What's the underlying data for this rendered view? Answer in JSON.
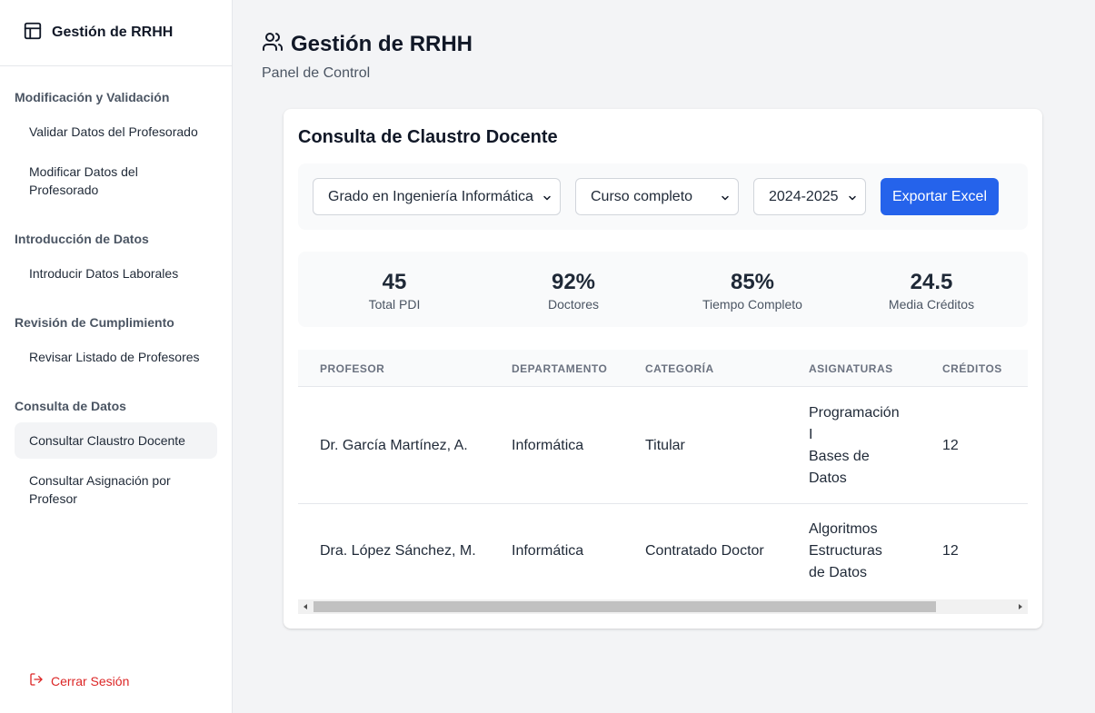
{
  "sidebar": {
    "brand": "Gestión de RRHH",
    "sections": [
      {
        "title": "Modificación y Validación",
        "items": [
          "Validar Datos del Profesorado",
          "Modificar Datos del Profesorado"
        ]
      },
      {
        "title": "Introducción de Datos",
        "items": [
          "Introducir Datos Laborales"
        ]
      },
      {
        "title": "Revisión de Cumplimiento",
        "items": [
          "Revisar Listado de Profesores"
        ]
      },
      {
        "title": "Consulta de Datos",
        "items": [
          "Consultar Claustro Docente",
          "Consultar Asignación por Profesor"
        ]
      }
    ],
    "active_item": "Consultar Claustro Docente",
    "logout": "Cerrar Sesión"
  },
  "header": {
    "title": "Gestión de RRHH",
    "subtitle": "Panel de Control"
  },
  "card": {
    "title": "Consulta de Claustro Docente",
    "filters": {
      "degree": "Grado en Ingeniería Informática",
      "course": "Curso completo",
      "year": "2024-2025",
      "export_label": "Exportar Excel"
    },
    "stats": [
      {
        "value": "45",
        "label": "Total PDI"
      },
      {
        "value": "92%",
        "label": "Doctores"
      },
      {
        "value": "85%",
        "label": "Tiempo Completo"
      },
      {
        "value": "24.5",
        "label": "Media Créditos"
      }
    ],
    "table": {
      "columns": [
        "PROFESOR",
        "DEPARTAMENTO",
        "CATEGORÍA",
        "ASIGNATURAS",
        "CRÉDITOS"
      ],
      "rows": [
        {
          "profesor": "Dr. García Martínez, A.",
          "departamento": "Informática",
          "categoria": "Titular",
          "asignaturas": [
            "Programación I",
            "Bases de Datos"
          ],
          "creditos": "12"
        },
        {
          "profesor": "Dra. López Sánchez, M.",
          "departamento": "Informática",
          "categoria": "Contratado Doctor",
          "asignaturas": [
            "Algoritmos",
            "Estructuras de Datos"
          ],
          "creditos": "12"
        }
      ]
    }
  },
  "colors": {
    "accent": "#2563eb",
    "logout": "#dc2626",
    "background": "#f3f4f6"
  },
  "icons": {
    "brand": "layout-icon",
    "header": "users-icon",
    "logout": "logout-icon"
  }
}
